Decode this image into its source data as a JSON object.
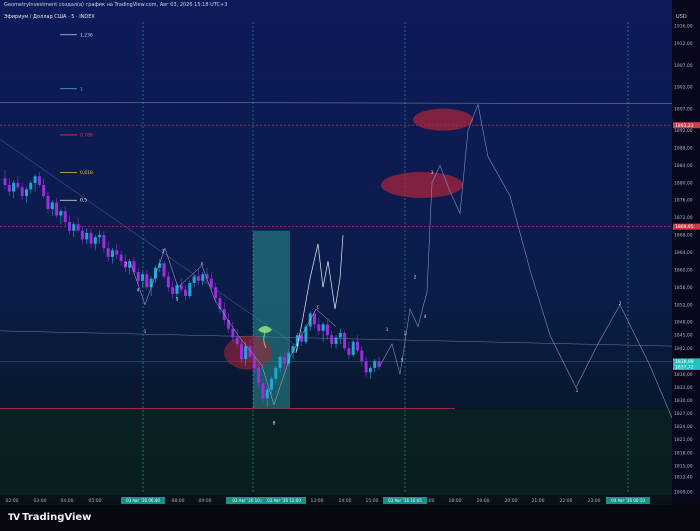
{
  "header": {
    "attribution": "GeometryInvestment создал(а) график на TradingView.com, Авг 03, 2026 15:18 UTC+3",
    "symbol": "Эфириум / Доллар США · 5 · INDEX",
    "currency": "USD"
  },
  "footer": {
    "logo": "TradingView"
  },
  "colors": {
    "background_top": "#0e1a5a",
    "background_bottom": "#07110f",
    "candle_up": "#1ea8d6",
    "candle_down": "#9b2ee0",
    "box_fill": "#2a8f8f",
    "dash_line": "#3a9d9a",
    "price_badge_red": "#d23a4a",
    "price_badge_cyan": "#21c2c2",
    "ellipse_red": "#b3243a"
  },
  "chart_data": {
    "type": "candlestick",
    "title": "Эфириум / Доллар США · 5 · INDEX",
    "xlabel": "",
    "ylabel": "",
    "ylim": [
      1809.0,
      1919.0
    ],
    "x_tick_labels": [
      "02:00",
      "03:00",
      "04:00",
      "05:00",
      "08:00",
      "09:00",
      "13:00",
      "14:00",
      "15:00",
      "17:00",
      "18:00",
      "19:00",
      "20:00",
      "21:00",
      "22:00",
      "23:00"
    ],
    "x_highlighted_labels": [
      "03 Авг '26 06:40",
      "03 Авг '26 10:4",
      "03 Авг '26 12:00",
      "03 Авг '26 16:05",
      "04 Авг '26 00:10"
    ],
    "y_tick_labels": [
      "1916,00",
      "1912,00",
      "1907,00",
      "1902,00",
      "1897,00",
      "1892,00",
      "1888,00",
      "1884,00",
      "1880,00",
      "1876,00",
      "1872,00",
      "1868,00",
      "1864,00",
      "1860,00",
      "1856,00",
      "1852,00",
      "1848,00",
      "1845,00",
      "1842,00",
      "1839,00",
      "1836,00",
      "1833,00",
      "1830,00",
      "1827,00",
      "1824,00",
      "1821,00",
      "1818,00",
      "1815,00",
      "1812,40",
      "1809,00"
    ],
    "y_tick_values": [
      1916,
      1912,
      1907,
      1902,
      1897,
      1892,
      1888,
      1884,
      1880,
      1876,
      1872,
      1868,
      1864,
      1860,
      1856,
      1852,
      1848,
      1845,
      1842,
      1839,
      1836,
      1833,
      1830,
      1827,
      1824,
      1821,
      1818,
      1815,
      1812.4,
      1809
    ],
    "price_badges": [
      {
        "text": "1893,23",
        "value": 1893.23,
        "color": "red"
      },
      {
        "text": "1869,95",
        "value": 1869.95,
        "color": "red"
      },
      {
        "text": "1838,99",
        "value": 1838.99,
        "color": "cyan"
      },
      {
        "text": "1837,72",
        "value": 1837.72,
        "color": "cyan"
      }
    ],
    "fib_levels": [
      {
        "label": "1,236",
        "value": 1914.0
      },
      {
        "label": "1",
        "value": 1901.6
      },
      {
        "label": "0,786",
        "value": 1891.0
      },
      {
        "label": "0,618",
        "value": 1882.4
      },
      {
        "label": "0,5",
        "value": 1876.0
      }
    ],
    "wave_labels": [
      {
        "text": "1"
      },
      {
        "text": "2"
      },
      {
        "text": "3"
      },
      {
        "text": "4"
      },
      {
        "text": "5"
      },
      {
        "text": "A"
      },
      {
        "text": "B"
      },
      {
        "text": "C"
      },
      {
        "text": "1"
      },
      {
        "text": "2"
      },
      {
        "text": "3"
      },
      {
        "text": "4"
      },
      {
        "text": "5"
      },
      {
        "text": "1"
      },
      {
        "text": "2"
      },
      {
        "text": "1"
      }
    ],
    "candles": [
      {
        "o": 1881.0,
        "h": 1883.0,
        "l": 1878.5,
        "c": 1879.5
      },
      {
        "o": 1879.5,
        "h": 1881.0,
        "l": 1877.0,
        "c": 1878.0
      },
      {
        "o": 1878.0,
        "h": 1880.5,
        "l": 1876.5,
        "c": 1880.0
      },
      {
        "o": 1880.0,
        "h": 1881.5,
        "l": 1878.5,
        "c": 1879.0
      },
      {
        "o": 1879.0,
        "h": 1880.0,
        "l": 1876.0,
        "c": 1877.0
      },
      {
        "o": 1877.0,
        "h": 1879.0,
        "l": 1875.5,
        "c": 1878.5
      },
      {
        "o": 1878.5,
        "h": 1880.5,
        "l": 1877.5,
        "c": 1880.0
      },
      {
        "o": 1880.0,
        "h": 1882.0,
        "l": 1878.0,
        "c": 1881.5
      },
      {
        "o": 1881.5,
        "h": 1882.5,
        "l": 1879.0,
        "c": 1879.5
      },
      {
        "o": 1879.5,
        "h": 1881.0,
        "l": 1876.5,
        "c": 1877.0
      },
      {
        "o": 1877.0,
        "h": 1878.0,
        "l": 1873.0,
        "c": 1874.0
      },
      {
        "o": 1874.0,
        "h": 1876.0,
        "l": 1872.5,
        "c": 1875.5
      },
      {
        "o": 1875.5,
        "h": 1876.5,
        "l": 1872.0,
        "c": 1872.5
      },
      {
        "o": 1872.5,
        "h": 1874.0,
        "l": 1870.5,
        "c": 1873.5
      },
      {
        "o": 1873.5,
        "h": 1874.5,
        "l": 1870.0,
        "c": 1871.0
      },
      {
        "o": 1871.0,
        "h": 1872.5,
        "l": 1868.0,
        "c": 1869.0
      },
      {
        "o": 1869.0,
        "h": 1871.0,
        "l": 1867.5,
        "c": 1870.5
      },
      {
        "o": 1870.5,
        "h": 1872.0,
        "l": 1868.5,
        "c": 1869.0
      },
      {
        "o": 1869.0,
        "h": 1870.0,
        "l": 1866.0,
        "c": 1867.0
      },
      {
        "o": 1867.0,
        "h": 1869.5,
        "l": 1866.0,
        "c": 1868.5
      },
      {
        "o": 1868.5,
        "h": 1869.5,
        "l": 1865.0,
        "c": 1866.0
      },
      {
        "o": 1866.0,
        "h": 1868.0,
        "l": 1864.5,
        "c": 1867.5
      },
      {
        "o": 1867.5,
        "h": 1869.0,
        "l": 1866.0,
        "c": 1868.0
      },
      {
        "o": 1868.0,
        "h": 1869.0,
        "l": 1864.0,
        "c": 1865.0
      },
      {
        "o": 1865.0,
        "h": 1866.5,
        "l": 1862.0,
        "c": 1863.0
      },
      {
        "o": 1863.0,
        "h": 1865.0,
        "l": 1861.5,
        "c": 1864.5
      },
      {
        "o": 1864.5,
        "h": 1866.0,
        "l": 1862.5,
        "c": 1863.5
      },
      {
        "o": 1863.5,
        "h": 1864.5,
        "l": 1861.0,
        "c": 1862.0
      },
      {
        "o": 1862.0,
        "h": 1863.5,
        "l": 1859.5,
        "c": 1860.5
      },
      {
        "o": 1860.5,
        "h": 1862.5,
        "l": 1859.0,
        "c": 1862.0
      },
      {
        "o": 1862.0,
        "h": 1863.0,
        "l": 1859.0,
        "c": 1859.5
      },
      {
        "o": 1859.5,
        "h": 1860.5,
        "l": 1856.5,
        "c": 1857.5
      },
      {
        "o": 1857.5,
        "h": 1859.5,
        "l": 1856.0,
        "c": 1859.0
      },
      {
        "o": 1859.0,
        "h": 1860.0,
        "l": 1855.5,
        "c": 1856.0
      },
      {
        "o": 1856.0,
        "h": 1858.5,
        "l": 1854.0,
        "c": 1858.0
      },
      {
        "o": 1858.0,
        "h": 1861.0,
        "l": 1857.0,
        "c": 1860.5
      },
      {
        "o": 1860.5,
        "h": 1862.5,
        "l": 1859.5,
        "c": 1861.5
      },
      {
        "o": 1861.5,
        "h": 1862.0,
        "l": 1858.0,
        "c": 1858.5
      },
      {
        "o": 1858.5,
        "h": 1859.5,
        "l": 1855.0,
        "c": 1856.0
      },
      {
        "o": 1856.0,
        "h": 1857.5,
        "l": 1853.5,
        "c": 1854.5
      },
      {
        "o": 1854.5,
        "h": 1857.0,
        "l": 1853.0,
        "c": 1856.5
      },
      {
        "o": 1856.5,
        "h": 1858.0,
        "l": 1855.0,
        "c": 1855.5
      },
      {
        "o": 1855.5,
        "h": 1856.5,
        "l": 1853.0,
        "c": 1854.0
      },
      {
        "o": 1854.0,
        "h": 1857.5,
        "l": 1853.5,
        "c": 1857.0
      },
      {
        "o": 1857.0,
        "h": 1859.0,
        "l": 1856.0,
        "c": 1858.5
      },
      {
        "o": 1858.5,
        "h": 1860.0,
        "l": 1856.5,
        "c": 1857.5
      },
      {
        "o": 1857.5,
        "h": 1859.5,
        "l": 1856.5,
        "c": 1859.0
      },
      {
        "o": 1859.0,
        "h": 1860.5,
        "l": 1857.0,
        "c": 1858.0
      },
      {
        "o": 1858.0,
        "h": 1859.5,
        "l": 1855.0,
        "c": 1856.0
      },
      {
        "o": 1856.0,
        "h": 1857.0,
        "l": 1852.5,
        "c": 1853.5
      },
      {
        "o": 1853.5,
        "h": 1854.5,
        "l": 1850.0,
        "c": 1851.0
      },
      {
        "o": 1851.0,
        "h": 1852.5,
        "l": 1847.5,
        "c": 1848.5
      },
      {
        "o": 1848.5,
        "h": 1850.0,
        "l": 1845.5,
        "c": 1846.5
      },
      {
        "o": 1846.5,
        "h": 1848.0,
        "l": 1843.5,
        "c": 1844.5
      },
      {
        "o": 1844.5,
        "h": 1846.5,
        "l": 1842.0,
        "c": 1843.0
      },
      {
        "o": 1843.0,
        "h": 1844.0,
        "l": 1838.5,
        "c": 1839.5
      },
      {
        "o": 1839.5,
        "h": 1843.5,
        "l": 1838.0,
        "c": 1842.5
      },
      {
        "o": 1842.5,
        "h": 1844.0,
        "l": 1839.0,
        "c": 1840.0
      },
      {
        "o": 1840.0,
        "h": 1841.0,
        "l": 1836.5,
        "c": 1837.5
      },
      {
        "o": 1837.5,
        "h": 1838.5,
        "l": 1833.0,
        "c": 1834.0
      },
      {
        "o": 1834.0,
        "h": 1835.0,
        "l": 1829.5,
        "c": 1830.5
      },
      {
        "o": 1830.5,
        "h": 1833.0,
        "l": 1828.5,
        "c": 1832.5
      },
      {
        "o": 1832.5,
        "h": 1835.5,
        "l": 1831.5,
        "c": 1835.0
      },
      {
        "o": 1835.0,
        "h": 1838.0,
        "l": 1834.0,
        "c": 1837.5
      },
      {
        "o": 1837.5,
        "h": 1840.5,
        "l": 1836.5,
        "c": 1840.0
      },
      {
        "o": 1840.0,
        "h": 1841.0,
        "l": 1837.0,
        "c": 1838.5
      },
      {
        "o": 1838.5,
        "h": 1841.5,
        "l": 1838.0,
        "c": 1841.0
      },
      {
        "o": 1841.0,
        "h": 1843.0,
        "l": 1839.5,
        "c": 1842.5
      },
      {
        "o": 1842.5,
        "h": 1845.5,
        "l": 1841.5,
        "c": 1845.0
      },
      {
        "o": 1845.0,
        "h": 1846.0,
        "l": 1842.5,
        "c": 1843.5
      },
      {
        "o": 1843.5,
        "h": 1847.5,
        "l": 1843.0,
        "c": 1847.0
      },
      {
        "o": 1847.0,
        "h": 1850.5,
        "l": 1846.0,
        "c": 1850.0
      },
      {
        "o": 1850.0,
        "h": 1850.5,
        "l": 1846.5,
        "c": 1847.5
      },
      {
        "o": 1847.5,
        "h": 1849.0,
        "l": 1845.0,
        "c": 1846.0
      },
      {
        "o": 1846.0,
        "h": 1848.0,
        "l": 1843.5,
        "c": 1847.5
      },
      {
        "o": 1847.5,
        "h": 1848.5,
        "l": 1844.0,
        "c": 1845.0
      },
      {
        "o": 1845.0,
        "h": 1846.0,
        "l": 1842.0,
        "c": 1843.0
      },
      {
        "o": 1843.0,
        "h": 1845.0,
        "l": 1842.0,
        "c": 1844.5
      },
      {
        "o": 1844.5,
        "h": 1846.5,
        "l": 1843.0,
        "c": 1845.5
      },
      {
        "o": 1845.5,
        "h": 1846.0,
        "l": 1841.5,
        "c": 1842.0
      },
      {
        "o": 1842.0,
        "h": 1843.5,
        "l": 1839.5,
        "c": 1840.5
      },
      {
        "o": 1840.5,
        "h": 1844.0,
        "l": 1840.0,
        "c": 1843.5
      },
      {
        "o": 1843.5,
        "h": 1845.0,
        "l": 1841.0,
        "c": 1841.5
      },
      {
        "o": 1841.5,
        "h": 1842.5,
        "l": 1838.0,
        "c": 1839.0
      },
      {
        "o": 1839.0,
        "h": 1840.0,
        "l": 1835.5,
        "c": 1836.5
      },
      {
        "o": 1836.5,
        "h": 1838.0,
        "l": 1835.0,
        "c": 1837.5
      },
      {
        "o": 1837.5,
        "h": 1839.5,
        "l": 1836.5,
        "c": 1839.0
      },
      {
        "o": 1839.0,
        "h": 1840.0,
        "l": 1837.0,
        "c": 1837.7
      }
    ]
  }
}
